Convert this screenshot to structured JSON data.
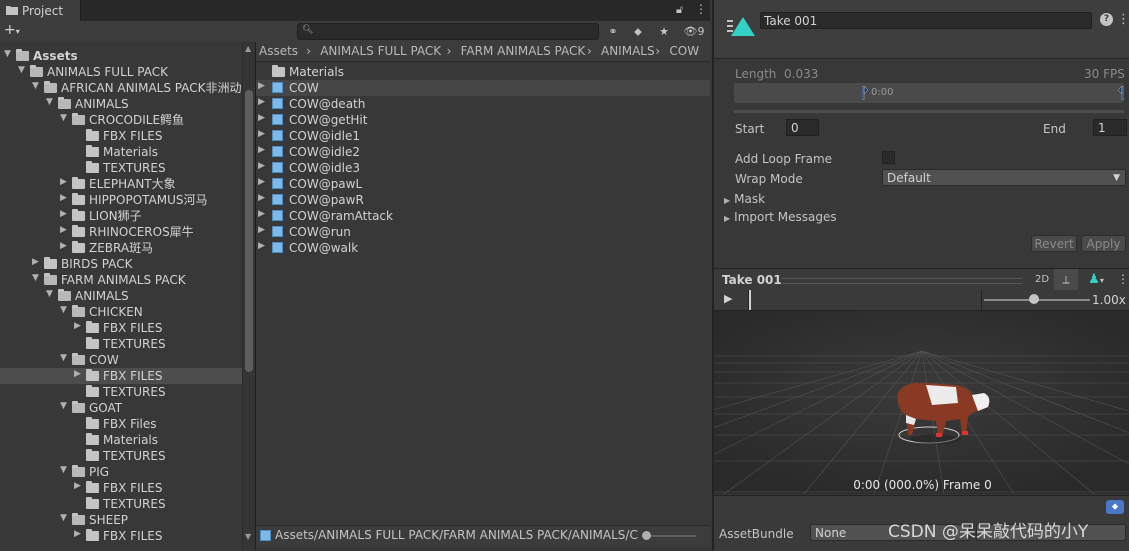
{
  "project_window": {
    "tab_title": "Project",
    "hidden_count": "9",
    "search_placeholder": "",
    "tree": [
      {
        "label": "Assets",
        "depth": 0,
        "expanded": true,
        "bold": true
      },
      {
        "label": "ANIMALS FULL PACK",
        "depth": 1,
        "expanded": true
      },
      {
        "label": "AFRICAN ANIMALS PACK非洲动",
        "depth": 2,
        "expanded": true
      },
      {
        "label": "ANIMALS",
        "depth": 3,
        "expanded": true
      },
      {
        "label": "CROCODILE鳄鱼",
        "depth": 4,
        "expanded": true
      },
      {
        "label": "FBX FILES",
        "depth": 5,
        "expanded": null
      },
      {
        "label": "Materials",
        "depth": 5,
        "expanded": null
      },
      {
        "label": "TEXTURES",
        "depth": 5,
        "expanded": null
      },
      {
        "label": "ELEPHANT大象",
        "depth": 4,
        "expanded": false
      },
      {
        "label": "HIPPOPOTAMUS河马",
        "depth": 4,
        "expanded": false
      },
      {
        "label": "LION狮子",
        "depth": 4,
        "expanded": false
      },
      {
        "label": "RHINOCEROS犀牛",
        "depth": 4,
        "expanded": false
      },
      {
        "label": "ZEBRA斑马",
        "depth": 4,
        "expanded": false
      },
      {
        "label": "BIRDS PACK",
        "depth": 2,
        "expanded": false
      },
      {
        "label": "FARM ANIMALS PACK",
        "depth": 2,
        "expanded": true
      },
      {
        "label": "ANIMALS",
        "depth": 3,
        "expanded": true
      },
      {
        "label": "CHICKEN",
        "depth": 4,
        "expanded": true
      },
      {
        "label": "FBX FILES",
        "depth": 5,
        "expanded": false
      },
      {
        "label": "TEXTURES",
        "depth": 5,
        "expanded": null
      },
      {
        "label": "COW",
        "depth": 4,
        "expanded": true
      },
      {
        "label": "FBX FILES",
        "depth": 5,
        "expanded": false,
        "selected": true
      },
      {
        "label": "TEXTURES",
        "depth": 5,
        "expanded": null
      },
      {
        "label": "GOAT",
        "depth": 4,
        "expanded": true
      },
      {
        "label": "FBX Files",
        "depth": 5,
        "expanded": null
      },
      {
        "label": "Materials",
        "depth": 5,
        "expanded": null
      },
      {
        "label": "TEXTURES",
        "depth": 5,
        "expanded": null
      },
      {
        "label": "PIG",
        "depth": 4,
        "expanded": true
      },
      {
        "label": "FBX FILES",
        "depth": 5,
        "expanded": false
      },
      {
        "label": "TEXTURES",
        "depth": 5,
        "expanded": null
      },
      {
        "label": "SHEEP",
        "depth": 4,
        "expanded": true
      },
      {
        "label": "FBX FILES",
        "depth": 5,
        "expanded": false
      }
    ],
    "breadcrumb": [
      "Assets",
      "ANIMALS FULL PACK",
      "FARM ANIMALS PACK",
      "ANIMALS",
      "COW"
    ],
    "assets": [
      {
        "label": "Materials",
        "kind": "folder"
      },
      {
        "label": "COW",
        "kind": "model",
        "selected": true
      },
      {
        "label": "COW@death",
        "kind": "model"
      },
      {
        "label": "COW@getHit",
        "kind": "model"
      },
      {
        "label": "COW@idle1",
        "kind": "model"
      },
      {
        "label": "COW@idle2",
        "kind": "model"
      },
      {
        "label": "COW@idle3",
        "kind": "model"
      },
      {
        "label": "COW@pawL",
        "kind": "model"
      },
      {
        "label": "COW@pawR",
        "kind": "model"
      },
      {
        "label": "COW@ramAttack",
        "kind": "model"
      },
      {
        "label": "COW@run",
        "kind": "model"
      },
      {
        "label": "COW@walk",
        "kind": "model"
      }
    ],
    "status_path": "Assets/ANIMALS FULL PACK/FARM ANIMALS PACK/ANIMALS/C"
  },
  "inspector": {
    "take_name": "Take 001",
    "length_label": "Length",
    "length_value": "0.033",
    "fps": "30 FPS",
    "timeline_label": "0:00",
    "start_label": "Start",
    "start_value": "0",
    "end_label": "End",
    "end_value": "1",
    "loop_label": "Add Loop Frame",
    "loop_checked": false,
    "wrap_label": "Wrap Mode",
    "wrap_value": "Default",
    "mask_label": "Mask",
    "import_label": "Import Messages",
    "revert_label": "Revert",
    "apply_label": "Apply",
    "preview_title": "Take 001",
    "btn_2d": "2D",
    "speed": "1.00x",
    "frame_readout": "0:00 (000.0%) Frame 0",
    "bundle_label": "AssetBundle",
    "bundle_value": "None"
  },
  "watermark": "CSDN @呆呆敲代码的小Y",
  "colors": {
    "accent_teal": "#34d1c6",
    "model_blue": "#7fb9e6",
    "selection": "#4d4d4d",
    "background": "#383838"
  }
}
